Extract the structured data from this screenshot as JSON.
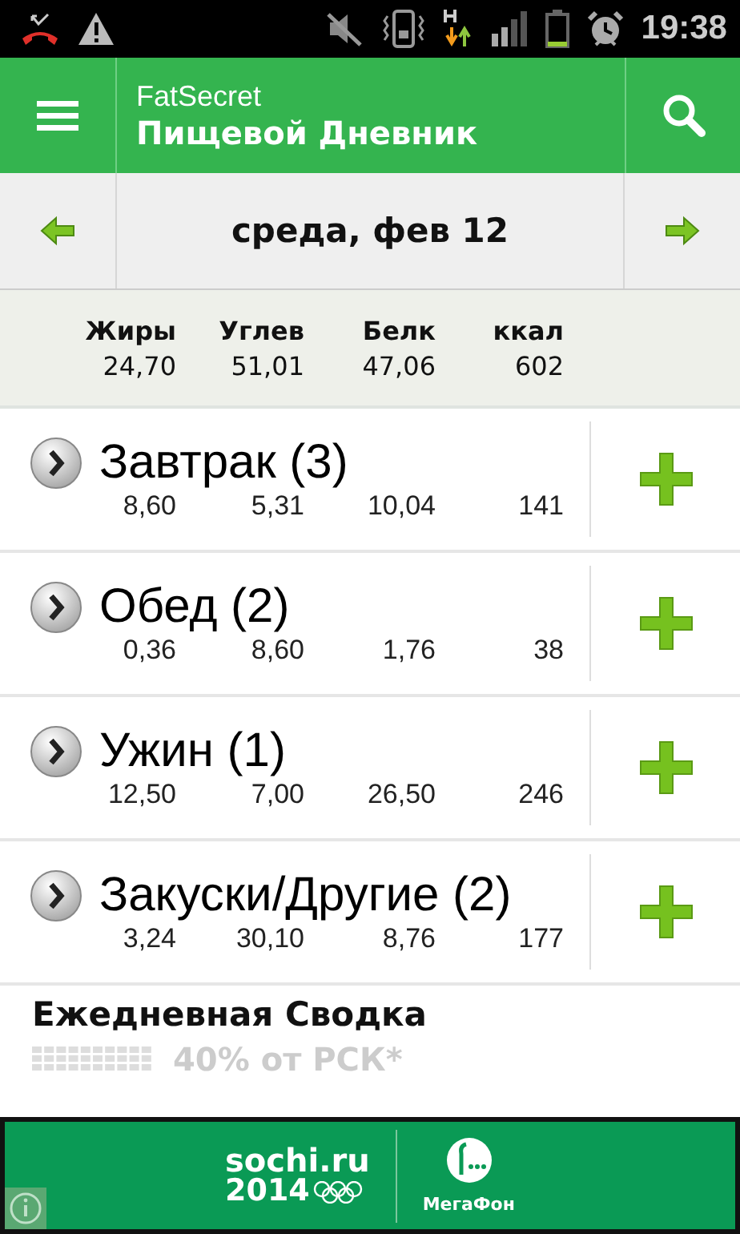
{
  "status_bar": {
    "time": "19:38"
  },
  "app_bar": {
    "app_name": "FatSecret",
    "title": "Пищевой Дневник"
  },
  "date_nav": {
    "date": "среда, фев 12"
  },
  "totals": [
    {
      "label": "Жиры",
      "value": "24,70"
    },
    {
      "label": "Углев",
      "value": "51,01"
    },
    {
      "label": "Белк",
      "value": "47,06"
    },
    {
      "label": "ккал",
      "value": "602"
    }
  ],
  "meals": [
    {
      "name": "Завтрак (3)",
      "values": [
        "8,60",
        "5,31",
        "10,04",
        "141"
      ]
    },
    {
      "name": "Обед (2)",
      "values": [
        "0,36",
        "8,60",
        "1,76",
        "38"
      ]
    },
    {
      "name": "Ужин (1)",
      "values": [
        "12,50",
        "7,00",
        "26,50",
        "246"
      ]
    },
    {
      "name": "Закуски/Другие (2)",
      "values": [
        "3,24",
        "30,10",
        "8,76",
        "177"
      ]
    }
  ],
  "daily_summary": {
    "title": "Ежедневная Сводка",
    "rdi": "40% от РСК*"
  },
  "ad_banner": {
    "left_logo": "sochi.ru",
    "year": "2014",
    "right_logo": "МегаФон"
  }
}
